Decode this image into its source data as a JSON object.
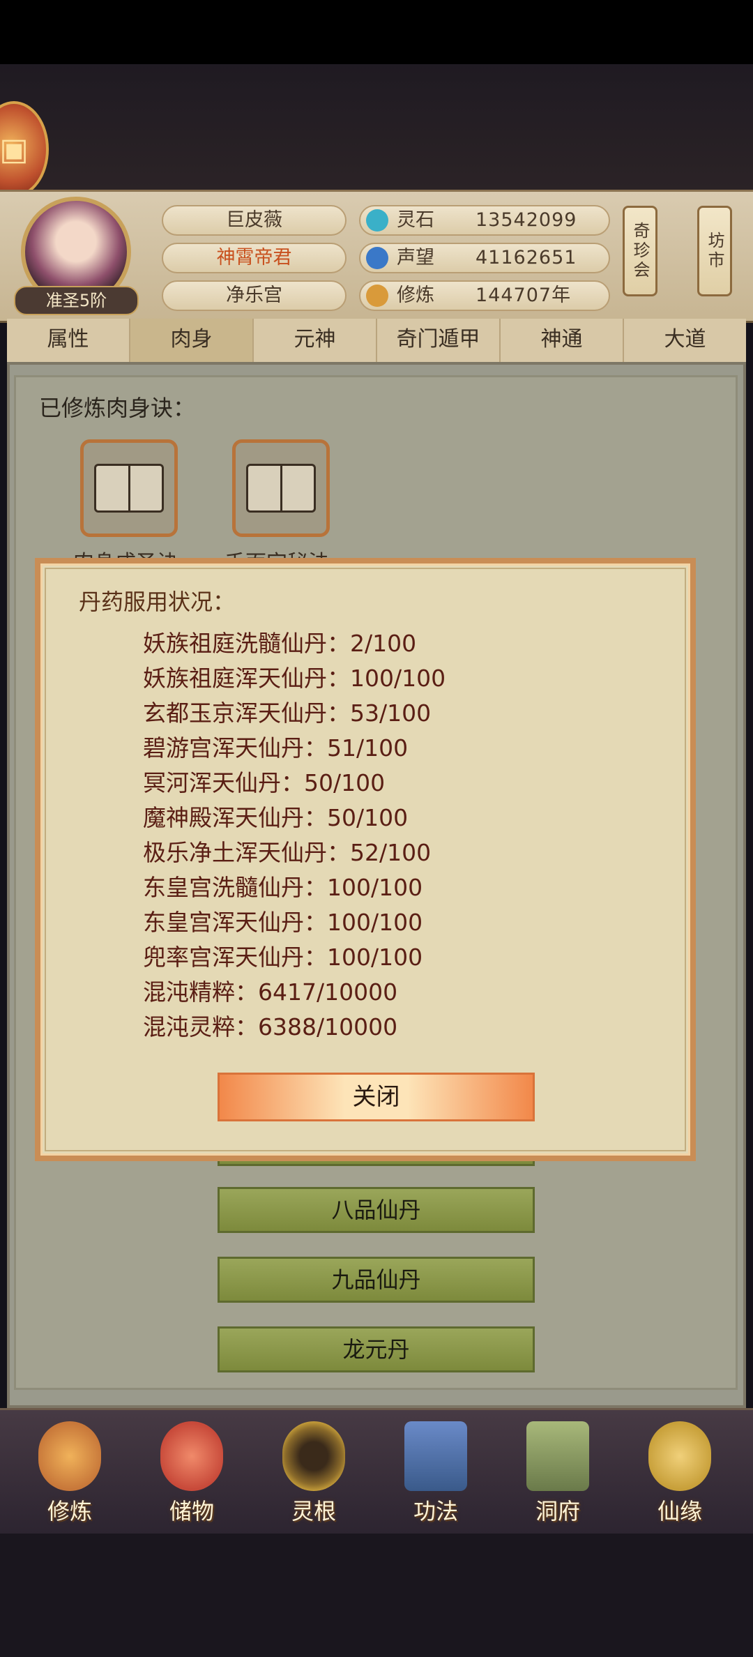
{
  "header": {
    "rank": "准圣5阶",
    "name": "巨皮薇",
    "title": "神霄帝君",
    "sect": "净乐宫",
    "stats": [
      {
        "label": "灵石",
        "value": "13542099",
        "icon": "spirit-stone-icon",
        "color": "#3ab0c8"
      },
      {
        "label": "声望",
        "value": "41162651",
        "icon": "prestige-icon",
        "color": "#3a78c8"
      },
      {
        "label": "修炼",
        "value": "144707年",
        "icon": "meditation-icon",
        "color": "#d99a3a"
      }
    ],
    "side_buttons": [
      "奇珍会",
      "坊市"
    ]
  },
  "tabs": [
    "属性",
    "肉身",
    "元神",
    "奇门遁甲",
    "神通",
    "大道"
  ],
  "active_tab": "肉身",
  "main": {
    "learned_title": "已修炼肉身诀：",
    "books": [
      "肉身成圣诀",
      "千面宫秘法"
    ],
    "pill_buttons": [
      "八品仙丹",
      "九品仙丹",
      "龙元丹"
    ]
  },
  "dialog": {
    "title": "丹药服用状况：",
    "pills": [
      "妖族祖庭洗髓仙丹：2/100",
      "妖族祖庭浑天仙丹：100/100",
      "玄都玉京浑天仙丹：53/100",
      "碧游宫浑天仙丹：51/100",
      "冥河浑天仙丹：50/100",
      "魔神殿浑天仙丹：50/100",
      "极乐净土浑天仙丹：52/100",
      "东皇宫洗髓仙丹：100/100",
      "东皇宫浑天仙丹：100/100",
      "兜率宫浑天仙丹：100/100",
      "混沌精粹：6417/10000",
      "混沌灵粹：6388/10000"
    ],
    "close_label": "关闭"
  },
  "bottom_nav": [
    {
      "label": "修炼",
      "icon": "cultivate-icon",
      "color": "#c8783a"
    },
    {
      "label": "储物",
      "icon": "storage-bag-icon",
      "color": "#c84a3a"
    },
    {
      "label": "灵根",
      "icon": "spirit-root-icon",
      "color": "#8a6a2a"
    },
    {
      "label": "功法",
      "icon": "technique-book-icon",
      "color": "#3a5a8a"
    },
    {
      "label": "洞府",
      "icon": "cave-mansion-icon",
      "color": "#6a7a4a"
    },
    {
      "label": "仙缘",
      "icon": "destiny-gourd-icon",
      "color": "#c8a03a"
    }
  ]
}
